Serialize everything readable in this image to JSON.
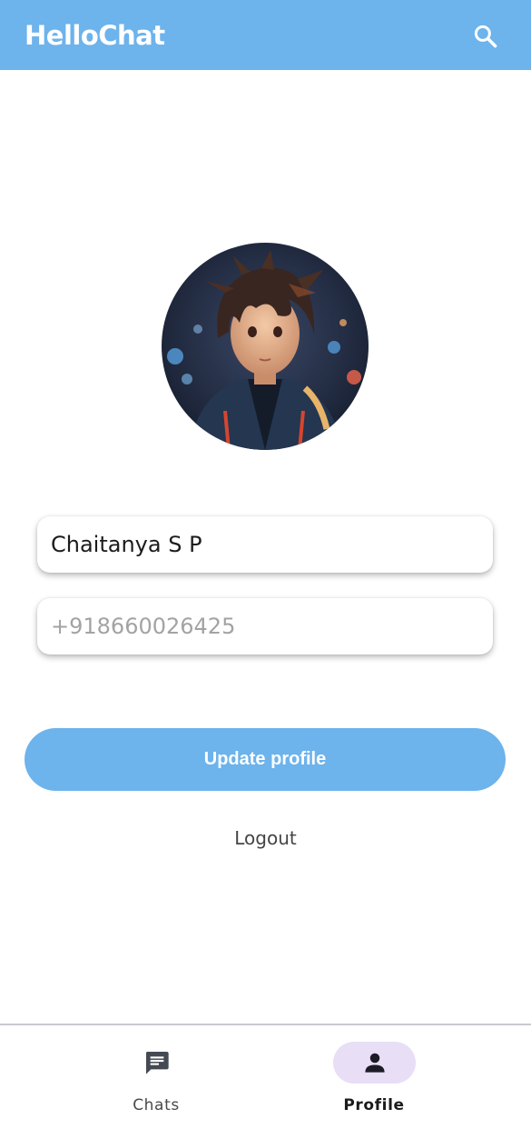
{
  "app": {
    "title": "HelloChat"
  },
  "profile": {
    "name_value": "Chaitanya S P",
    "phone_placeholder": "+918660026425",
    "update_label": "Update profile",
    "logout_label": "Logout"
  },
  "bottom_nav": {
    "items": [
      {
        "label": "Chats",
        "icon": "chat-icon",
        "selected": false
      },
      {
        "label": "Profile",
        "icon": "person-icon",
        "selected": true
      }
    ]
  },
  "colors": {
    "accent": "#6db3ec",
    "nav_indicator": "#e8def6"
  }
}
